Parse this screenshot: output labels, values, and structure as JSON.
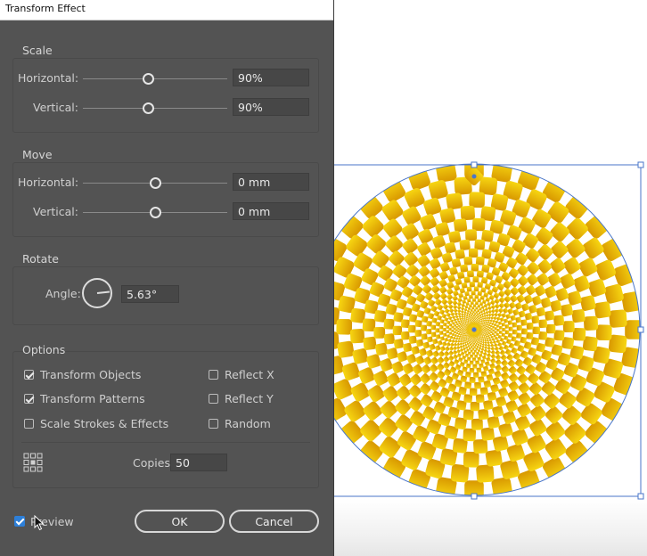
{
  "window": {
    "title": "Transform Effect"
  },
  "scale": {
    "title": "Scale",
    "horizontal_label": "Horizontal:",
    "horizontal_value": "90%",
    "vertical_label": "Vertical:",
    "vertical_value": "90%"
  },
  "move": {
    "title": "Move",
    "horizontal_label": "Horizontal:",
    "horizontal_value": "0 mm",
    "vertical_label": "Vertical:",
    "vertical_value": "0 mm"
  },
  "rotate": {
    "title": "Rotate",
    "angle_label": "Angle:",
    "angle_value": "5.63°"
  },
  "options": {
    "title": "Options",
    "transform_objects": "Transform Objects",
    "transform_patterns": "Transform Patterns",
    "scale_strokes": "Scale Strokes & Effects",
    "reflect_x": "Reflect X",
    "reflect_y": "Reflect Y",
    "random": "Random",
    "copies_label": "Copies",
    "copies_value": "50"
  },
  "footer": {
    "preview_label": "Preview",
    "ok_label": "OK",
    "cancel_label": "Cancel"
  },
  "colors": {
    "accent": "#2d7fd8",
    "tile_light": "#f5d10a",
    "tile_dark": "#d99a00",
    "selection": "#4a76c8"
  },
  "icons": {
    "reference_point": "reference-point-grid-icon",
    "angle": "angle-dial-icon",
    "cursor": "mouse-pointer-icon"
  }
}
